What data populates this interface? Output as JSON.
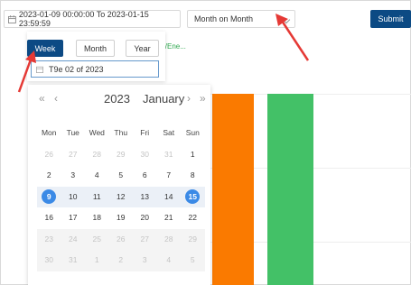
{
  "toolbar": {
    "date_range": "2023-01-09 00:00:00 To 2023-01-15 23:59:59",
    "compare_mode": "Month on Month",
    "submit_label": "Submit"
  },
  "chart": {
    "legend_fragment": "N/Ene...",
    "bar_colors": [
      "#fa7a00",
      "#43c167"
    ]
  },
  "week_picker": {
    "modes": [
      "Week",
      "Month",
      "Year"
    ],
    "active_mode": "Week",
    "value": "T9e 02 of 2023"
  },
  "calendar": {
    "year": "2023",
    "month": "January",
    "nav": {
      "prev_year": "«",
      "prev_month": "‹",
      "next_month": "›",
      "next_year": "»"
    },
    "weekdays": [
      "Mon",
      "Tue",
      "Wed",
      "Thu",
      "Fri",
      "Sat",
      "Sun"
    ],
    "weeks": [
      [
        "26",
        "27",
        "28",
        "29",
        "30",
        "31",
        "1"
      ],
      [
        "2",
        "3",
        "4",
        "5",
        "6",
        "7",
        "8"
      ],
      [
        "9",
        "10",
        "11",
        "12",
        "13",
        "14",
        "15"
      ],
      [
        "16",
        "17",
        "18",
        "19",
        "20",
        "21",
        "22"
      ],
      [
        "23",
        "24",
        "25",
        "26",
        "27",
        "28",
        "29"
      ],
      [
        "30",
        "31",
        "1",
        "2",
        "3",
        "4",
        "5"
      ]
    ]
  },
  "colors": {
    "accent": "#0c4a84",
    "selected_day": "#3b8ae6",
    "annotation_arrow": "#e53935"
  }
}
